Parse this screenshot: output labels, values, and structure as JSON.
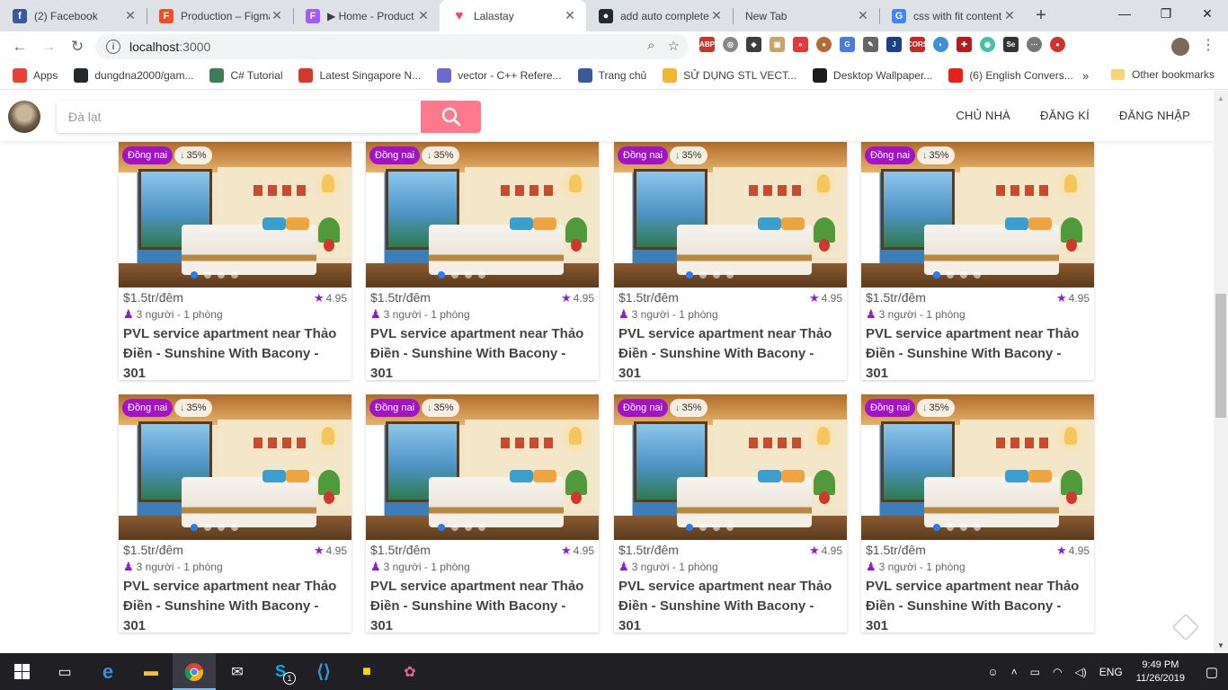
{
  "browser": {
    "tabs": [
      {
        "title": "(2) Facebook",
        "icon": "facebook-icon",
        "color": "#3b5998",
        "glyph": "f"
      },
      {
        "title": "Production – Figma",
        "icon": "figma-icon",
        "color": "#f24e1e",
        "glyph": "F"
      },
      {
        "title": "▶ Home - Product",
        "icon": "figma-icon",
        "color": "#a259ff",
        "glyph": "F"
      },
      {
        "title": "Lalastay",
        "icon": "heart-icon",
        "color": "#e84a5f",
        "glyph": "♥"
      },
      {
        "title": "add auto complete",
        "icon": "github-icon",
        "color": "#24292e",
        "glyph": "●"
      },
      {
        "title": "New Tab",
        "icon": "",
        "color": "",
        "glyph": ""
      },
      {
        "title": "css with fit content",
        "icon": "google-icon",
        "color": "#4285f4",
        "glyph": "G"
      }
    ],
    "active_tab": 3,
    "url_host": "localhost",
    "url_port": ":3000",
    "bookmarks": [
      {
        "label": "Apps",
        "icon": "apps-grid-icon",
        "color": "#e94235"
      },
      {
        "label": "dungdna2000/gam...",
        "icon": "github-icon",
        "color": "#24292e"
      },
      {
        "label": "C# Tutorial",
        "icon": "diamond-icon",
        "color": "#3f7d58"
      },
      {
        "label": "Latest Singapore N...",
        "icon": "news-icon",
        "color": "#d23a2d"
      },
      {
        "label": "vector - C++ Refere...",
        "icon": "cpp-icon",
        "color": "#6d6ad0"
      },
      {
        "label": "Trang chủ",
        "icon": "facebook-icon",
        "color": "#3b5998"
      },
      {
        "label": "SỬ DỤNG STL VECT...",
        "icon": "bookmark-icon",
        "color": "#f2b632"
      },
      {
        "label": "Desktop Wallpaper...",
        "icon": "wallpaper-icon",
        "color": "#1c1c1c"
      },
      {
        "label": "(6) English Convers...",
        "icon": "youtube-icon",
        "color": "#e62117"
      }
    ],
    "bookmarks_more": "»",
    "other_bookmarks": "Other bookmarks"
  },
  "site": {
    "search_placeholder": "Đà lạt",
    "nav": [
      "CHỦ NHÀ",
      "ĐĂNG KÍ",
      "ĐĂNG NHẬP"
    ],
    "brand_color": "#fd7a8c"
  },
  "listings": [
    {
      "location": "Đồng nai",
      "discount": "35%",
      "price": "$1.5tr/đêm",
      "rating": "4.95",
      "capacity": "3 người - 1 phòng",
      "title": "PVL service apartment near Thảo Điền - Sunshine With Bacony - 301"
    },
    {
      "location": "Đồng nai",
      "discount": "35%",
      "price": "$1.5tr/đêm",
      "rating": "4.95",
      "capacity": "3 người - 1 phòng",
      "title": "PVL service apartment near Thảo Điền - Sunshine With Bacony - 301"
    },
    {
      "location": "Đồng nai",
      "discount": "35%",
      "price": "$1.5tr/đêm",
      "rating": "4.95",
      "capacity": "3 người - 1 phòng",
      "title": "PVL service apartment near Thảo Điền - Sunshine With Bacony - 301"
    },
    {
      "location": "Đồng nai",
      "discount": "35%",
      "price": "$1.5tr/đêm",
      "rating": "4.95",
      "capacity": "3 người - 1 phòng",
      "title": "PVL service apartment near Thảo Điền - Sunshine With Bacony - 301"
    },
    {
      "location": "Đồng nai",
      "discount": "35%",
      "price": "$1.5tr/đêm",
      "rating": "4.95",
      "capacity": "3 người - 1 phòng",
      "title": "PVL service apartment near Thảo Điền - Sunshine With Bacony - 301"
    },
    {
      "location": "Đồng nai",
      "discount": "35%",
      "price": "$1.5tr/đêm",
      "rating": "4.95",
      "capacity": "3 người - 1 phòng",
      "title": "PVL service apartment near Thảo Điền - Sunshine With Bacony - 301"
    },
    {
      "location": "Đồng nai",
      "discount": "35%",
      "price": "$1.5tr/đêm",
      "rating": "4.95",
      "capacity": "3 người - 1 phòng",
      "title": "PVL service apartment near Thảo Điền - Sunshine With Bacony - 301"
    },
    {
      "location": "Đồng nai",
      "discount": "35%",
      "price": "$1.5tr/đêm",
      "rating": "4.95",
      "capacity": "3 người - 1 phòng",
      "title": "PVL service apartment near Thảo Điền - Sunshine With Bacony - 301"
    }
  ],
  "taskbar": {
    "language": "ENG",
    "time": "9:49 PM",
    "date": "11/26/2019",
    "skype_badge": "1"
  }
}
